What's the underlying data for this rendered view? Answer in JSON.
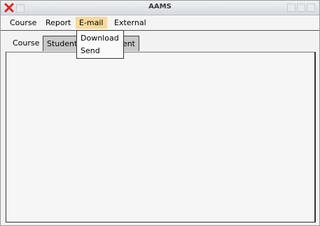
{
  "window": {
    "title": "AAMS"
  },
  "menubar": {
    "items": [
      {
        "label": "Course"
      },
      {
        "label": "Report"
      },
      {
        "label": "E-mail"
      },
      {
        "label": "External"
      }
    ]
  },
  "email_menu": {
    "items": [
      {
        "label": "Download"
      },
      {
        "label": "Send"
      }
    ]
  },
  "tabs": [
    {
      "label": "Course"
    },
    {
      "label": "Student"
    },
    {
      "label": "Assignment"
    }
  ],
  "colors": {
    "menu_active": "#f7d99a",
    "close_icon": "#d8281e"
  }
}
